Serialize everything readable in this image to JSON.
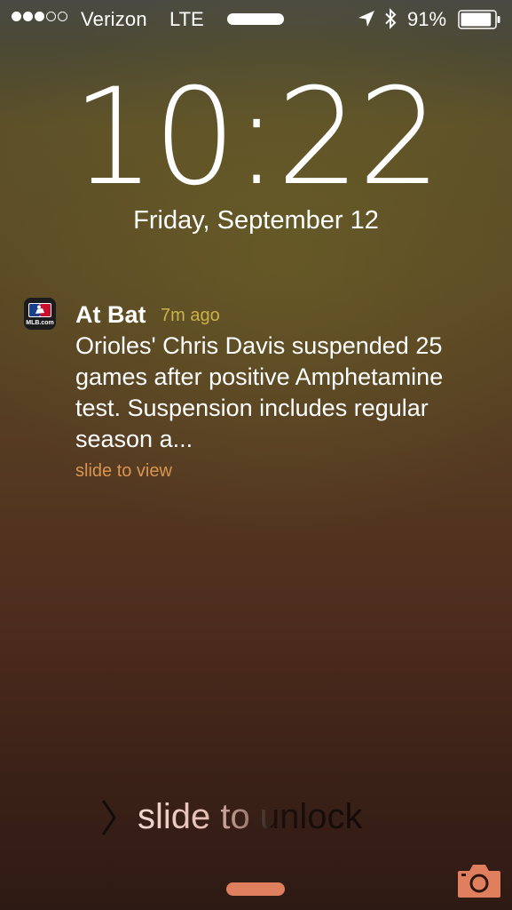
{
  "status_bar": {
    "signal_bars_filled": 3,
    "signal_bars_total": 5,
    "carrier": "Verizon",
    "network": "LTE",
    "location_icon": "location-arrow-icon",
    "bluetooth_icon": "bluetooth-icon",
    "battery_percent": "91%",
    "battery_level": 0.91
  },
  "lock_screen": {
    "time": "10:22",
    "date": "Friday, September 12"
  },
  "notification": {
    "app_icon": "mlb-icon",
    "app_icon_label": "MLB.com",
    "app_name": "At Bat",
    "time_ago": "7m ago",
    "message": "Orioles' Chris Davis suspended 25 games after positive Amphetamine test. Suspension includes regular season a...",
    "action": "slide to view"
  },
  "unlock": {
    "label": "slide to unlock",
    "chevron_icon": "chevron-right-icon"
  },
  "bottom": {
    "camera_icon": "camera-icon"
  },
  "colors": {
    "time_ago": "#c9b24a",
    "action": "#d99550",
    "accent": "#e07f5d"
  }
}
